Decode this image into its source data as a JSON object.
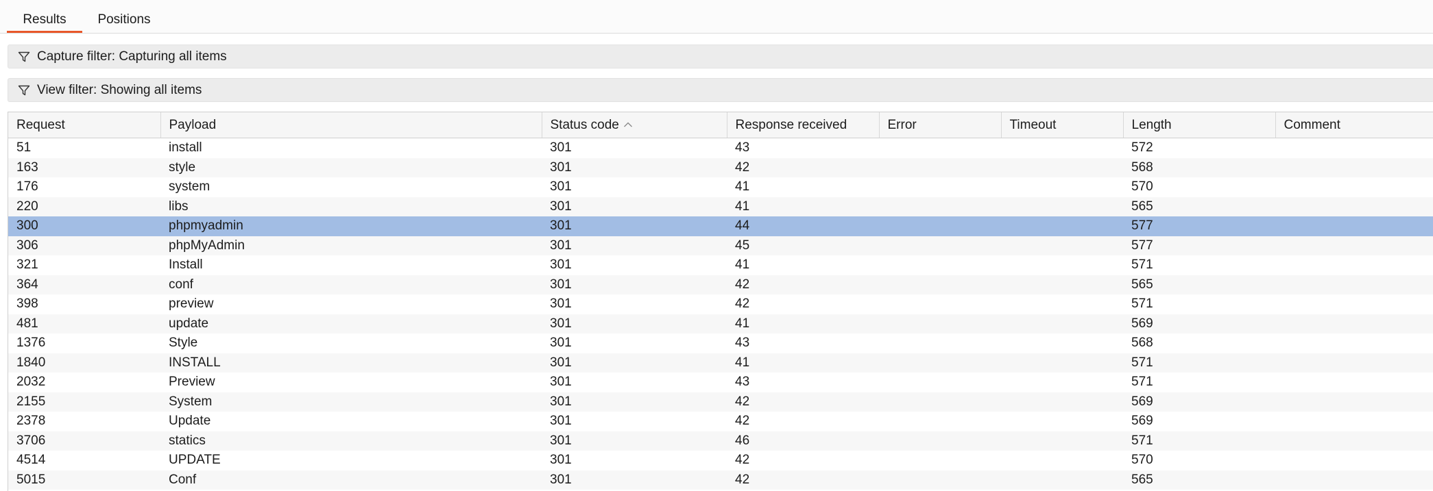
{
  "tabs": [
    {
      "label": "Results",
      "active": true
    },
    {
      "label": "Positions",
      "active": false
    }
  ],
  "capture_filter": {
    "label": "Capture filter: Capturing all items",
    "icon": "filter-icon"
  },
  "view_filter": {
    "label": "View filter: Showing all items",
    "icon": "filter-icon"
  },
  "table": {
    "columns": [
      "Request",
      "Payload",
      "Status code",
      "Response received",
      "Error",
      "Timeout",
      "Length",
      "Comment"
    ],
    "sort_column": "Status code",
    "sort_direction": "ascending",
    "selection_color": "#a2bde4",
    "rows": [
      {
        "request": "51",
        "payload": "install",
        "status": "301",
        "response": "43",
        "error": "",
        "timeout": "",
        "length": "572",
        "comment": ""
      },
      {
        "request": "163",
        "payload": "style",
        "status": "301",
        "response": "42",
        "error": "",
        "timeout": "",
        "length": "568",
        "comment": ""
      },
      {
        "request": "176",
        "payload": "system",
        "status": "301",
        "response": "41",
        "error": "",
        "timeout": "",
        "length": "570",
        "comment": ""
      },
      {
        "request": "220",
        "payload": "libs",
        "status": "301",
        "response": "41",
        "error": "",
        "timeout": "",
        "length": "565",
        "comment": ""
      },
      {
        "request": "300",
        "payload": "phpmyadmin",
        "status": "301",
        "response": "44",
        "error": "",
        "timeout": "",
        "length": "577",
        "comment": "",
        "selected": true
      },
      {
        "request": "306",
        "payload": "phpMyAdmin",
        "status": "301",
        "response": "45",
        "error": "",
        "timeout": "",
        "length": "577",
        "comment": ""
      },
      {
        "request": "321",
        "payload": "Install",
        "status": "301",
        "response": "41",
        "error": "",
        "timeout": "",
        "length": "571",
        "comment": ""
      },
      {
        "request": "364",
        "payload": "conf",
        "status": "301",
        "response": "42",
        "error": "",
        "timeout": "",
        "length": "565",
        "comment": ""
      },
      {
        "request": "398",
        "payload": "preview",
        "status": "301",
        "response": "42",
        "error": "",
        "timeout": "",
        "length": "571",
        "comment": ""
      },
      {
        "request": "481",
        "payload": "update",
        "status": "301",
        "response": "41",
        "error": "",
        "timeout": "",
        "length": "569",
        "comment": ""
      },
      {
        "request": "1376",
        "payload": "Style",
        "status": "301",
        "response": "43",
        "error": "",
        "timeout": "",
        "length": "568",
        "comment": ""
      },
      {
        "request": "1840",
        "payload": "INSTALL",
        "status": "301",
        "response": "41",
        "error": "",
        "timeout": "",
        "length": "571",
        "comment": ""
      },
      {
        "request": "2032",
        "payload": "Preview",
        "status": "301",
        "response": "43",
        "error": "",
        "timeout": "",
        "length": "571",
        "comment": ""
      },
      {
        "request": "2155",
        "payload": "System",
        "status": "301",
        "response": "42",
        "error": "",
        "timeout": "",
        "length": "569",
        "comment": ""
      },
      {
        "request": "2378",
        "payload": "Update",
        "status": "301",
        "response": "42",
        "error": "",
        "timeout": "",
        "length": "569",
        "comment": ""
      },
      {
        "request": "3706",
        "payload": "statics",
        "status": "301",
        "response": "46",
        "error": "",
        "timeout": "",
        "length": "571",
        "comment": ""
      },
      {
        "request": "4514",
        "payload": "UPDATE",
        "status": "301",
        "response": "42",
        "error": "",
        "timeout": "",
        "length": "570",
        "comment": ""
      },
      {
        "request": "5015",
        "payload": "Conf",
        "status": "301",
        "response": "42",
        "error": "",
        "timeout": "",
        "length": "565",
        "comment": ""
      }
    ]
  }
}
